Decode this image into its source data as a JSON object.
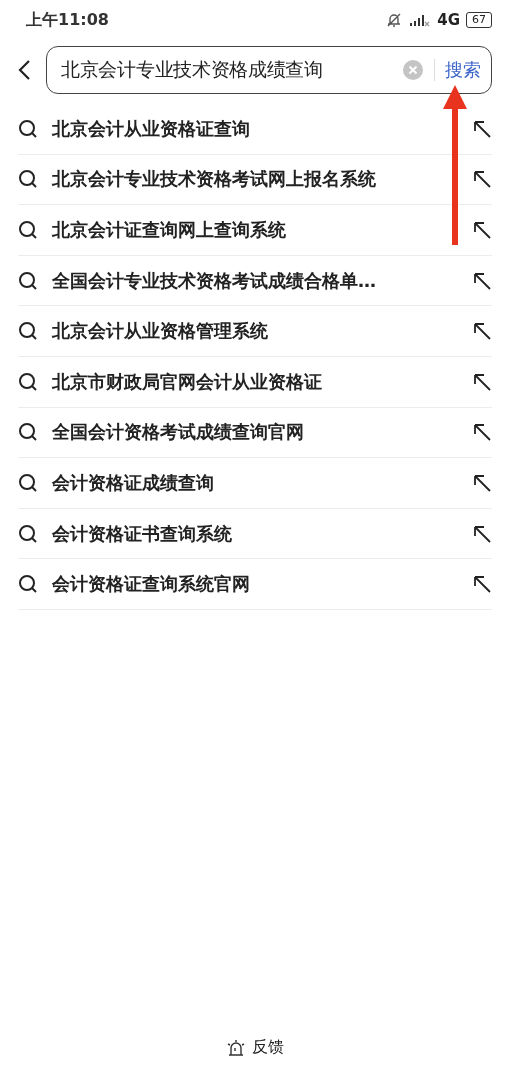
{
  "status_bar": {
    "time": "上午11:08",
    "network": "4G",
    "battery": "67"
  },
  "search": {
    "value": "北京会计专业技术资格成绩查询",
    "button": "搜索"
  },
  "suggestions": [
    {
      "text": "北京会计从业资格证查询"
    },
    {
      "text": "北京会计专业技术资格考试网上报名系统"
    },
    {
      "text": "北京会计证查询网上查询系统"
    },
    {
      "text": "全国会计专业技术资格考试成绩合格单…"
    },
    {
      "text": "北京会计从业资格管理系统"
    },
    {
      "text": "北京市财政局官网会计从业资格证"
    },
    {
      "text": "全国会计资格考试成绩查询官网"
    },
    {
      "text": "会计资格证成绩查询"
    },
    {
      "text": "会计资格证书查询系统"
    },
    {
      "text": "会计资格证查询系统官网"
    }
  ],
  "feedback": "反馈"
}
